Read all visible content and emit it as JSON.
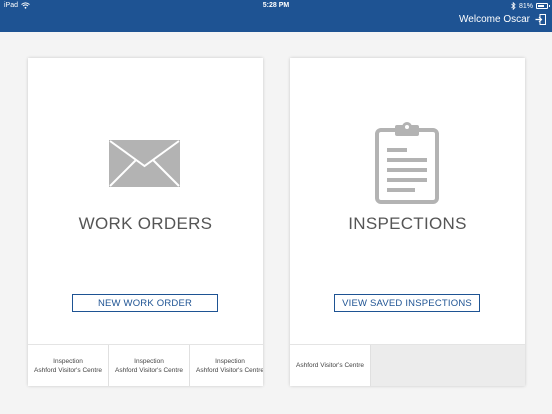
{
  "status_bar": {
    "device": "iPad",
    "time": "5:28 PM",
    "battery": "81%",
    "battery_level": 0.81
  },
  "header": {
    "welcome": "Welcome Oscar"
  },
  "cards": {
    "work_orders": {
      "title": "WORK ORDERS",
      "button": "NEW WORK ORDER",
      "items": [
        {
          "type": "Inspection",
          "location": "Ashford Visitor's Centre"
        },
        {
          "type": "Inspection",
          "location": "Ashford Visitor's Centre"
        },
        {
          "type": "Inspection",
          "location": "Ashford Visitor's Centre"
        }
      ]
    },
    "inspections": {
      "title": "INSPECTIONS",
      "button": "VIEW SAVED INSPECTIONS",
      "items": [
        {
          "location": "Ashford Visitor's Centre"
        }
      ]
    }
  },
  "colors": {
    "header_bg": "#1e5393",
    "icon_gray": "#b3b3b3",
    "button_accent": "#1e5393"
  }
}
